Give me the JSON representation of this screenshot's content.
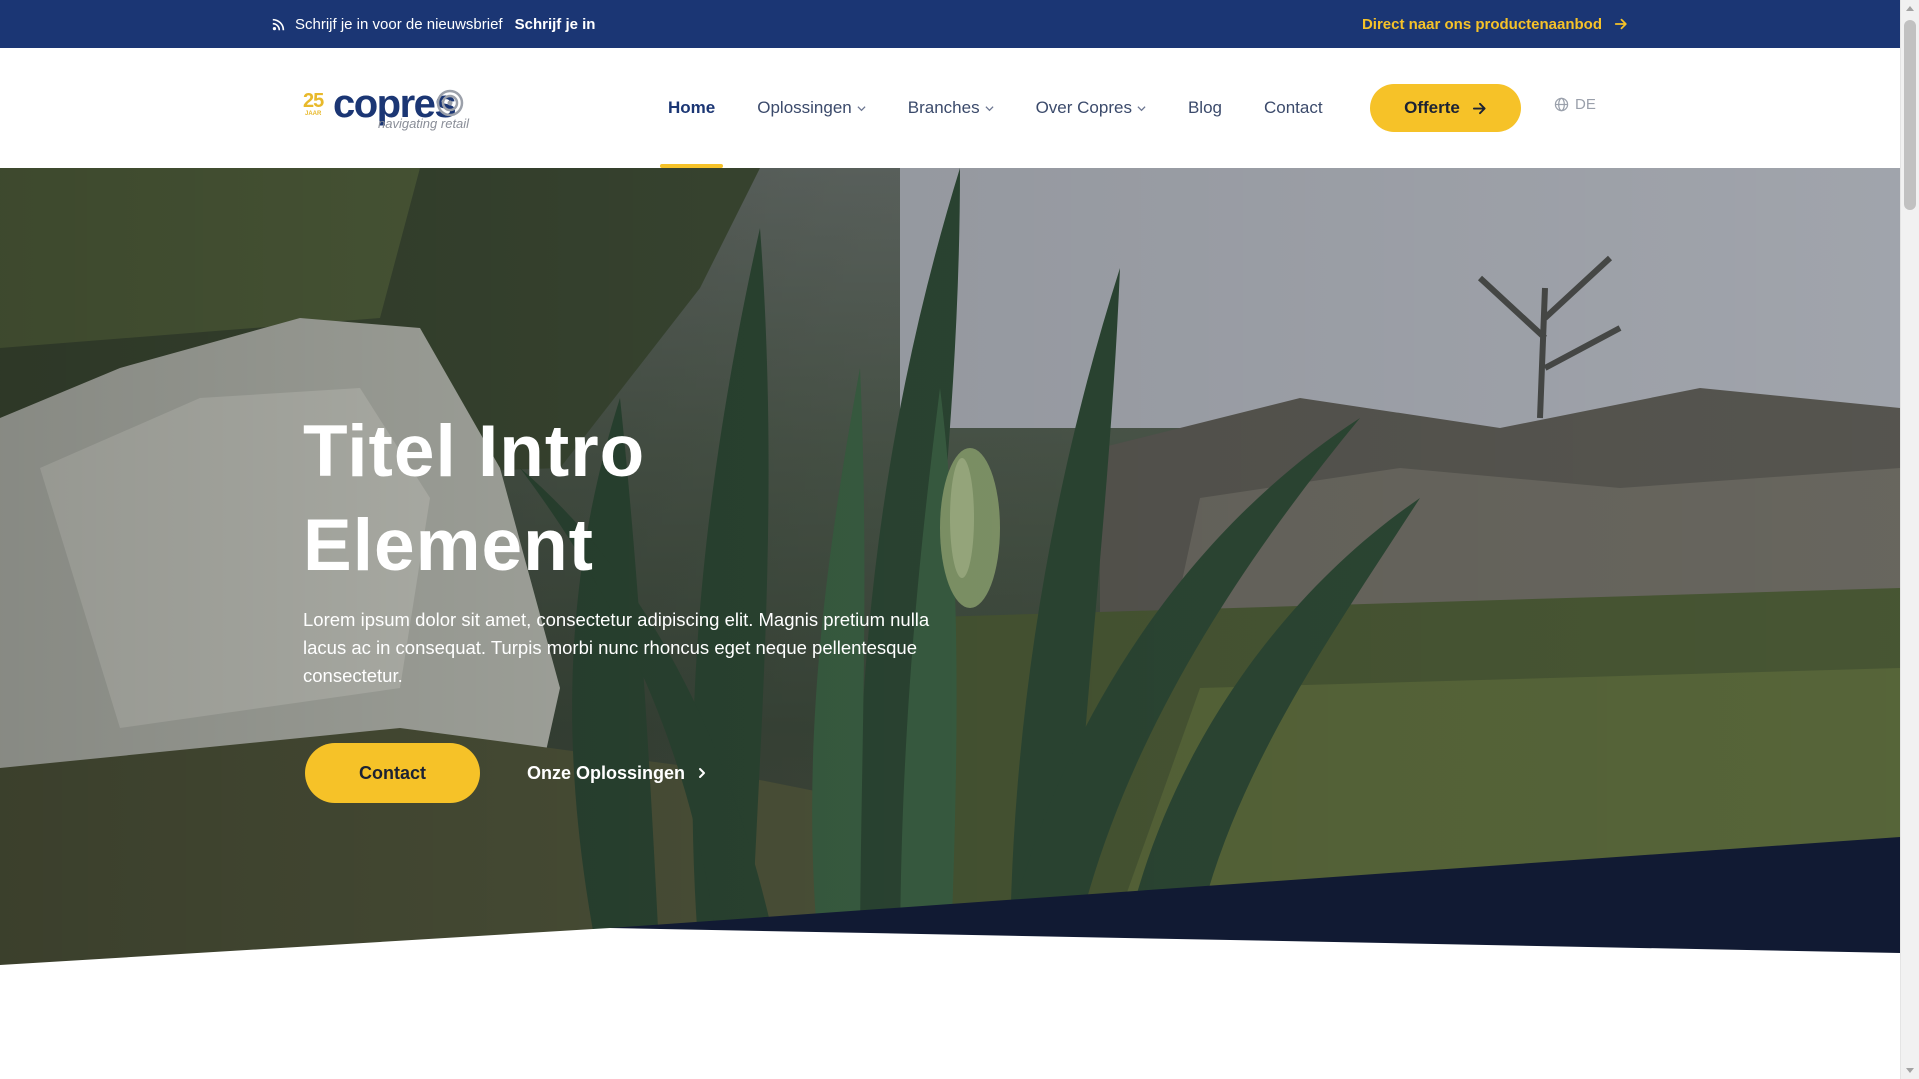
{
  "topbar": {
    "newsletter_text": "Schrijf je in voor de nieuwsbrief",
    "newsletter_link": "Schrijf je in",
    "products_link": "Direct naar ons productenaanbod"
  },
  "logo": {
    "years": "25",
    "years_sub": "JAAR",
    "name": "copres",
    "tagline": "navigating retail"
  },
  "nav": {
    "items": [
      {
        "label": "Home",
        "active": true
      },
      {
        "label": "Oplossingen",
        "dropdown": true
      },
      {
        "label": "Branches",
        "dropdown": true
      },
      {
        "label": "Over Copres",
        "dropdown": true
      },
      {
        "label": "Blog"
      },
      {
        "label": "Contact"
      }
    ],
    "cta_label": "Offerte",
    "language": "DE"
  },
  "hero": {
    "title_line1": "Titel Intro",
    "title_line2": "Element",
    "lead": "Lorem ipsum dolor sit amet, consectetur adipiscing elit. Magnis pretium nulla lacus ac in consequat. Turpis morbi nunc rhoncus eget neque pellentesque consectetur.",
    "primary_button": "Contact",
    "secondary_link": "Onze Oplossingen"
  },
  "colors": {
    "brand_navy": "#1b3674",
    "accent_yellow": "#f6c228",
    "dark_band": "#111a33"
  },
  "icons": {
    "rss": "rss-icon",
    "arrow": "arrow-right-icon",
    "chevron": "chevron-down-icon",
    "globe": "globe-icon",
    "chevron_right": "chevron-right-icon"
  }
}
